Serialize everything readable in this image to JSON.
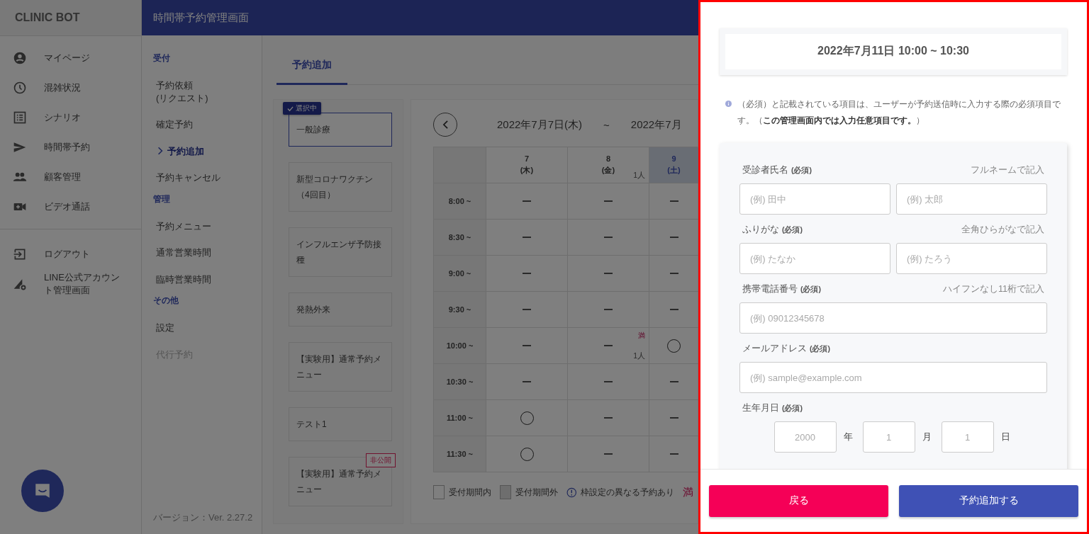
{
  "sidebar": {
    "brand": "CLINIC BOT",
    "items": [
      {
        "label": "マイページ"
      },
      {
        "label": "混雑状況"
      },
      {
        "label": "シナリオ"
      },
      {
        "label": "時間帯予約"
      },
      {
        "label": "顧客管理"
      },
      {
        "label": "ビデオ通話"
      }
    ],
    "secondary": [
      {
        "label": "ログアウト"
      },
      {
        "label": "LINE公式アカウント管理画面"
      }
    ]
  },
  "header": {
    "title": "時間帯予約管理画面"
  },
  "subnav": {
    "sections": [
      {
        "heading": "受付",
        "items": [
          {
            "label": "予約依頼\n(リクエスト)",
            "selected": false,
            "disabled": false
          },
          {
            "label": "確定予約",
            "selected": false,
            "disabled": false
          },
          {
            "label": "予約追加",
            "selected": true,
            "disabled": false
          },
          {
            "label": "予約キャンセル",
            "selected": false,
            "disabled": false
          }
        ]
      },
      {
        "heading": "管理",
        "items": [
          {
            "label": "予約メニュー",
            "selected": false,
            "disabled": false
          },
          {
            "label": "通常営業時間",
            "selected": false,
            "disabled": false
          },
          {
            "label": "臨時営業時間",
            "selected": false,
            "disabled": false
          }
        ]
      },
      {
        "heading": "その他",
        "items": [
          {
            "label": "設定",
            "selected": false,
            "disabled": false
          },
          {
            "label": "代行予約",
            "selected": false,
            "disabled": true
          }
        ]
      }
    ],
    "version": "バージョン：Ver. 2.27.2"
  },
  "tabs": [
    {
      "label": "予約追加",
      "selected": true
    }
  ],
  "menus": [
    {
      "label": "一般診療",
      "selected": true,
      "badge": "選択中"
    },
    {
      "label": "新型コロナワクチン（4回目）",
      "selected": false
    },
    {
      "label": "インフルエンザ予防接種",
      "selected": false
    },
    {
      "label": "発熱外来",
      "selected": false
    },
    {
      "label": "【実験用】通常予約メニュー",
      "selected": false
    },
    {
      "label": "テスト1",
      "selected": false
    },
    {
      "label": "【実験用】通常予約メニュー",
      "selected": false,
      "badge": "非公開"
    }
  ],
  "calendar": {
    "range_start": "2022年7月7日(木)",
    "range_sep": "~",
    "range_end": "2022年7月",
    "columns": [
      {
        "day": "7",
        "weekday": "(木)",
        "holiday": false
      },
      {
        "day": "8",
        "weekday": "(金)",
        "count": "1人",
        "holiday": false
      },
      {
        "day": "9",
        "weekday": "(土)",
        "holiday": true
      }
    ],
    "rows": [
      {
        "time": "8:00 ~",
        "cells": [
          {
            "kind": "none"
          },
          {
            "kind": "none"
          },
          {
            "kind": "none"
          }
        ]
      },
      {
        "time": "8:30 ~",
        "cells": [
          {
            "kind": "none"
          },
          {
            "kind": "none"
          },
          {
            "kind": "none"
          }
        ]
      },
      {
        "time": "9:00 ~",
        "cells": [
          {
            "kind": "none"
          },
          {
            "kind": "none"
          },
          {
            "kind": "none"
          }
        ]
      },
      {
        "time": "9:30 ~",
        "cells": [
          {
            "kind": "none"
          },
          {
            "kind": "none"
          },
          {
            "kind": "none"
          }
        ]
      },
      {
        "time": "10:00 ~",
        "cells": [
          {
            "kind": "none"
          },
          {
            "kind": "none",
            "flag": "満",
            "count": "1人"
          },
          {
            "kind": "open"
          }
        ]
      },
      {
        "time": "10:30 ~",
        "cells": [
          {
            "kind": "none"
          },
          {
            "kind": "none"
          },
          {
            "kind": "none"
          }
        ]
      },
      {
        "time": "11:00 ~",
        "cells": [
          {
            "kind": "open"
          },
          {
            "kind": "none"
          },
          {
            "kind": "none"
          }
        ]
      },
      {
        "time": "11:30 ~",
        "cells": [
          {
            "kind": "open"
          },
          {
            "kind": "none"
          },
          {
            "kind": "none"
          }
        ]
      }
    ],
    "legend": [
      {
        "kind": "in",
        "label": "受付期間内"
      },
      {
        "kind": "out",
        "label": "受付期間外"
      },
      {
        "kind": "alert",
        "label": "枠設定の異なる予約あり"
      },
      {
        "kind": "full",
        "label": "満"
      }
    ]
  },
  "drawer": {
    "datetime": "2022年7月11日 10:00 ~ 10:30",
    "notice": "（必須）と記載されている項目は、ユーザーが予約送信時に入力する際の必須項目です。（**この管理画面内では入力任意項目です。**）",
    "fields": [
      {
        "label": "受診者氏名",
        "required": "(必須)",
        "hint": "フルネームで記入",
        "placeholders": [
          "(例) 田中",
          "(例) 太郎"
        ]
      },
      {
        "label": "ふりがな",
        "required": "(必須)",
        "hint": "全角ひらがなで記入",
        "placeholders": [
          "(例) たなか",
          "(例) たろう"
        ]
      },
      {
        "label": "携帯電話番号",
        "required": "(必須)",
        "hint": "ハイフンなし11桁で記入",
        "placeholders": [
          "(例) 09012345678"
        ]
      },
      {
        "label": "メールアドレス",
        "required": "(必須)",
        "placeholders": [
          "(例) sample@example.com"
        ]
      }
    ],
    "birthday": {
      "label": "生年月日",
      "required": "(必須)",
      "parts": [
        {
          "placeholder": "2000",
          "unit": "年"
        },
        {
          "placeholder": "1",
          "unit": "月"
        },
        {
          "placeholder": "1",
          "unit": "日"
        }
      ]
    },
    "buttons": [
      {
        "label": "戻る",
        "kind": "back"
      },
      {
        "label": "予約追加する",
        "kind": "submit"
      }
    ]
  }
}
